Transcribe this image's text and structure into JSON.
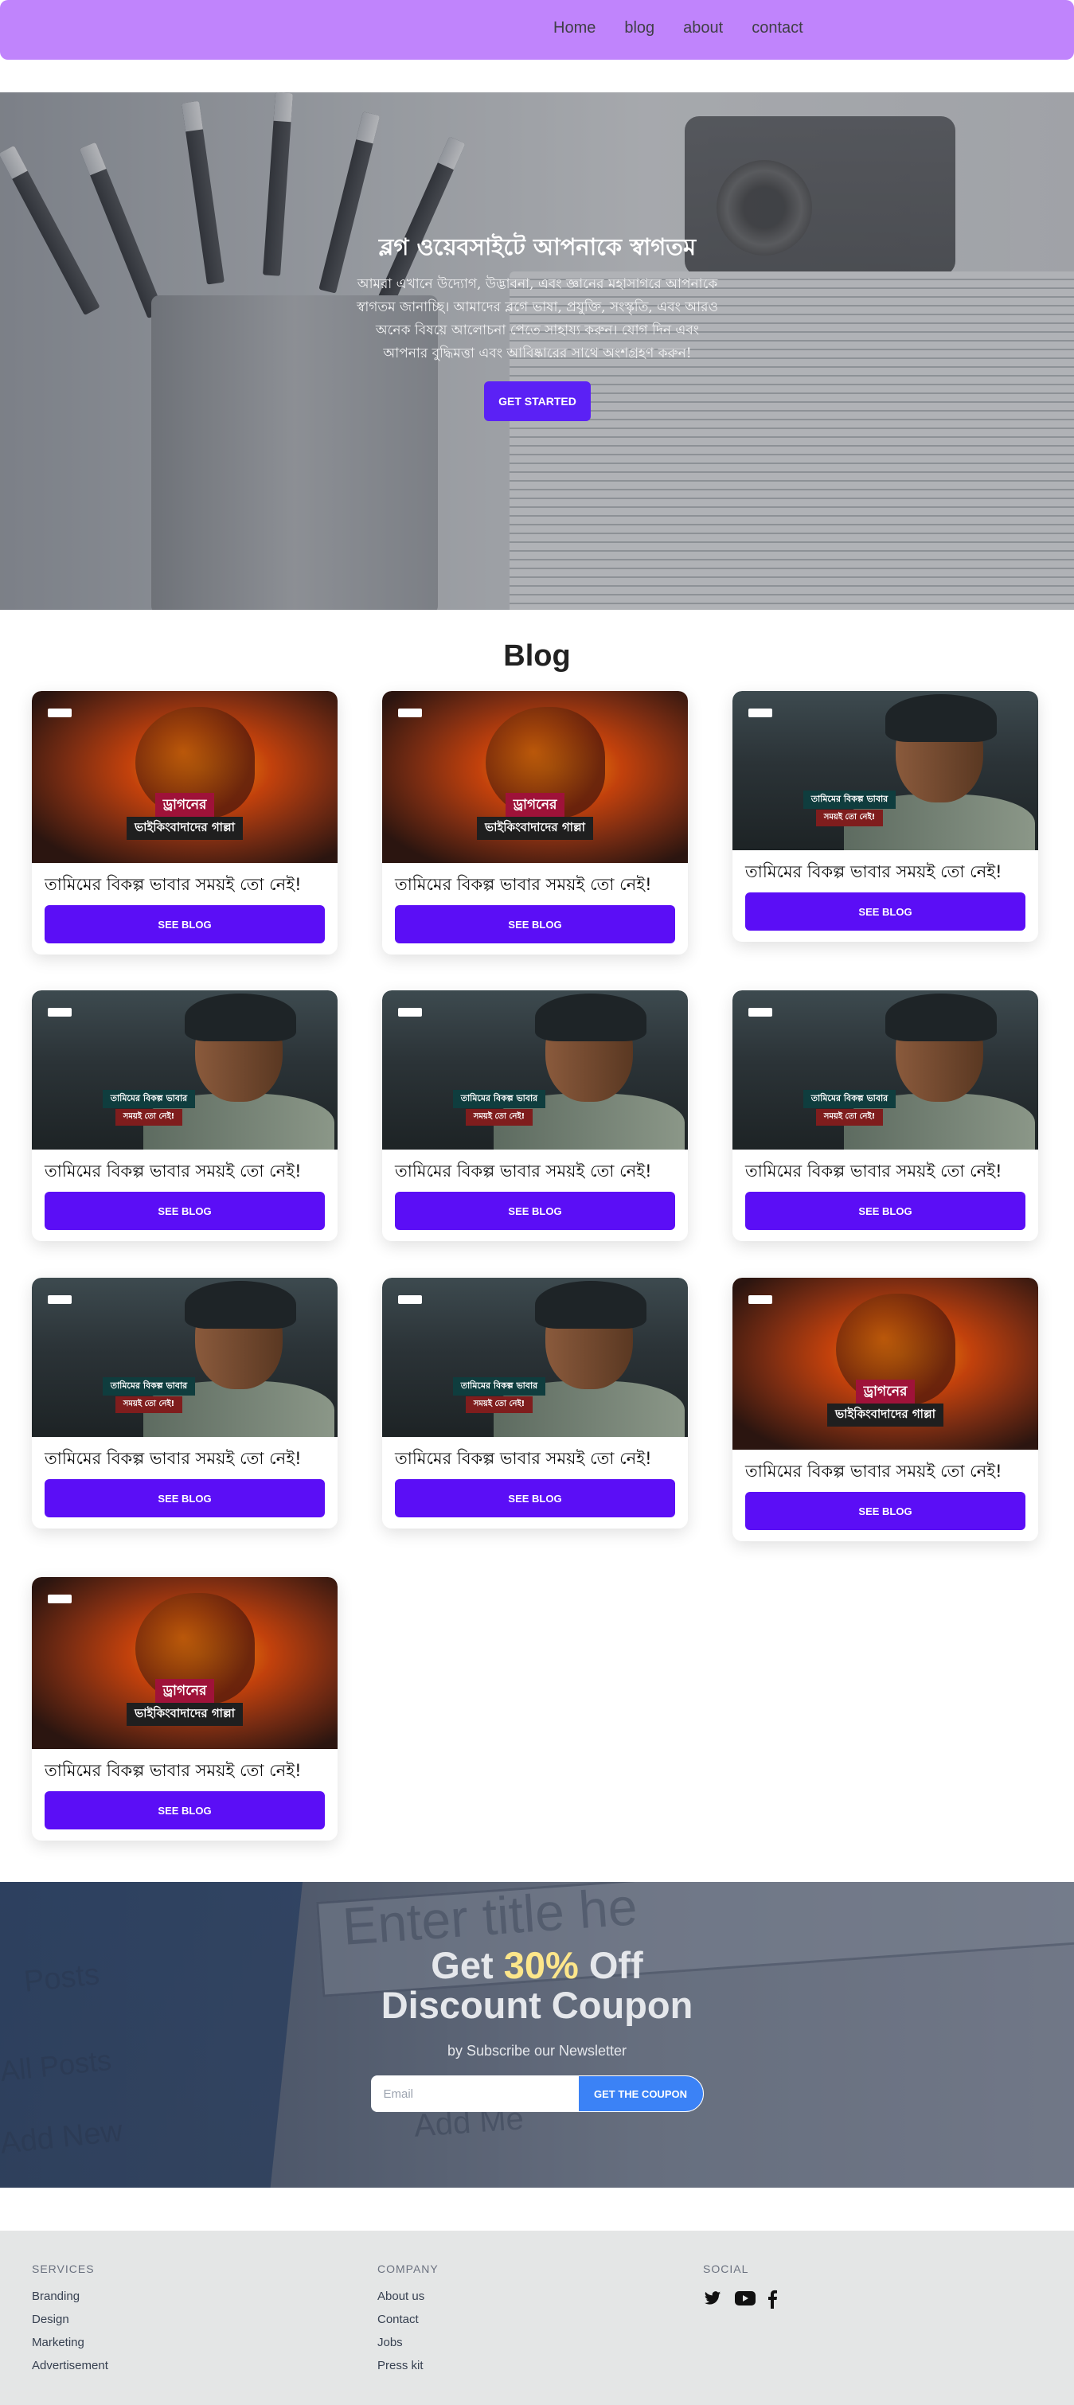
{
  "nav": {
    "links": [
      "Home",
      "blog",
      "about",
      "contact"
    ]
  },
  "hero": {
    "title": "ব্লগ ওয়েবসাইটে আপনাকে স্বাগতম",
    "text": "আমরা এখানে উদ্যোগ, উদ্ভাবনা, এবং জ্ঞানের মহাসাগরে আপনাকে স্বাগতম জানাচ্ছি। আমাদের ব্লগে ভাষা, প্রযুক্তি, সংস্কৃতি, এবং আরও অনেক বিষয়ে আলোচনা পেতে সাহায্য করুন। যোগ দিন এবং আপনার বুদ্ধিমত্তা এবং আবিষ্কারের সাথে অংশগ্রহণ করুন!",
    "button": "GET STARTED"
  },
  "blog": {
    "heading": "Blog",
    "cards": [
      {
        "image": "dragon",
        "title": "তামিমের বিকল্প ভাবার সময়ই তো নেই!",
        "button": "SEE BLOG",
        "cap1": "ড্রাগনের",
        "cap2": "ভাইকিংবাদাদের গাল্লা"
      },
      {
        "image": "dragon",
        "title": "তামিমের বিকল্প ভাবার সময়ই তো নেই!",
        "button": "SEE BLOG",
        "cap1": "ড্রাগনের",
        "cap2": "ভাইকিংবাদাদের গাল্লা"
      },
      {
        "image": "man",
        "title": "তামিমের বিকল্প ভাবার সময়ই তো নেই!",
        "button": "SEE BLOG",
        "cap1": "তামিমের বিকল্প ভাবার",
        "cap2": "সময়ই তো নেই!"
      },
      {
        "image": "man",
        "title": "তামিমের বিকল্প ভাবার সময়ই তো নেই!",
        "button": "SEE BLOG",
        "cap1": "তামিমের বিকল্প ভাবার",
        "cap2": "সময়ই তো নেই!"
      },
      {
        "image": "man",
        "title": "তামিমের বিকল্প ভাবার সময়ই তো নেই!",
        "button": "SEE BLOG",
        "cap1": "তামিমের বিকল্প ভাবার",
        "cap2": "সময়ই তো নেই!"
      },
      {
        "image": "man",
        "title": "তামিমের বিকল্প ভাবার সময়ই তো নেই!",
        "button": "SEE BLOG",
        "cap1": "তামিমের বিকল্প ভাবার",
        "cap2": "সময়ই তো নেই!"
      },
      {
        "image": "man",
        "title": "তামিমের বিকল্প ভাবার সময়ই তো নেই!",
        "button": "SEE BLOG",
        "cap1": "তামিমের বিকল্প ভাবার",
        "cap2": "সময়ই তো নেই!"
      },
      {
        "image": "man",
        "title": "তামিমের বিকল্প ভাবার সময়ই তো নেই!",
        "button": "SEE BLOG",
        "cap1": "তামিমের বিকল্প ভাবার",
        "cap2": "সময়ই তো নেই!"
      },
      {
        "image": "dragon",
        "title": "তামিমের বিকল্প ভাবার সময়ই তো নেই!",
        "button": "SEE BLOG",
        "cap1": "ড্রাগনের",
        "cap2": "ভাইকিংবাদাদের গাল্লা"
      },
      {
        "image": "dragon",
        "title": "তামিমের বিকল্প ভাবার সময়ই তো নেই!",
        "button": "SEE BLOG",
        "cap1": "ড্রাগনের",
        "cap2": "ভাইকিংবাদাদের গাল্লা"
      }
    ]
  },
  "coupon": {
    "title_pre": "Get ",
    "title_pct": "30%",
    "title_post": " Off",
    "title_line2": "Discount Coupon",
    "subtitle": "by Subscribe our Newsletter",
    "email_placeholder": "Email",
    "button": "GET THE COUPON",
    "bg_text_1": "Enter title he",
    "bg_text_2": "Posts",
    "bg_text_3": "All Posts",
    "bg_text_4": "Add New",
    "bg_text_5": "Add Me"
  },
  "footer": {
    "services": {
      "heading": "SERVICES",
      "links": [
        "Branding",
        "Design",
        "Marketing",
        "Advertisement"
      ]
    },
    "company": {
      "heading": "COMPANY",
      "links": [
        "About us",
        "Contact",
        "Jobs",
        "Press kit"
      ]
    },
    "social": {
      "heading": "SOCIAL",
      "icons": [
        "twitter-icon",
        "youtube-icon",
        "facebook-icon"
      ]
    }
  },
  "colors": {
    "nav_bg": "#c084fc",
    "primary_button": "#5b0ef6",
    "coupon_button": "#3b82f6",
    "coupon_highlight": "#fde68a",
    "footer_bg": "#e4e6e6"
  }
}
